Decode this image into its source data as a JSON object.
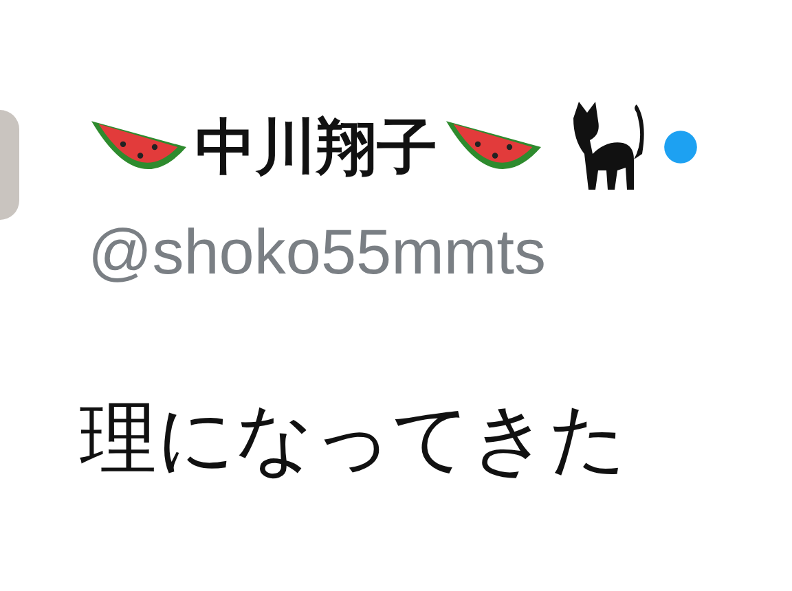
{
  "author": {
    "name": "中川翔子",
    "handle": "@shoko55mmts",
    "verified": true
  },
  "tweet": {
    "text": "理になってきた"
  }
}
